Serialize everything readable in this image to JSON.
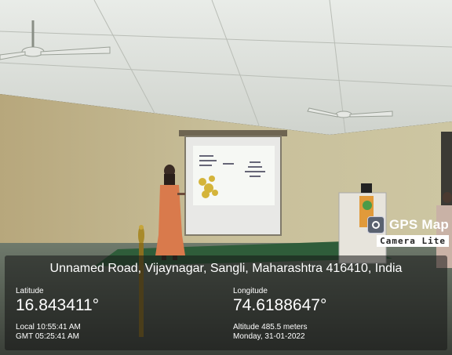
{
  "badge": {
    "title": "GPS Map",
    "subtitle": "Camera Lite"
  },
  "address": "Unnamed Road, Vijaynagar, Sangli, Maharashtra 416410, India",
  "latitude": {
    "label": "Latitude",
    "value": "16.843411°"
  },
  "longitude": {
    "label": "Longitude",
    "value": "74.6188647°"
  },
  "local_time": "Local 10:55:41 AM",
  "gmt_time": "GMT 05:25:41 AM",
  "altitude": "Altitude 485.5 meters",
  "date": "Monday, 31-01-2022",
  "colors": {
    "wall": "#bfb78f",
    "ceiling": "#d9dcd6",
    "carpet": "#2f5d3a",
    "overlay": "#161616"
  }
}
